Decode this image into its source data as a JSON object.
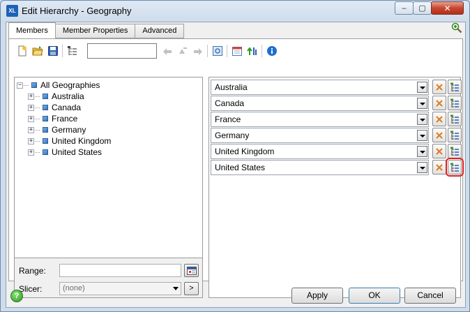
{
  "window": {
    "app_icon_text": "XL",
    "title": "Edit Hierarchy - Geography",
    "controls": {
      "minimize": "–",
      "maximize": "▢",
      "close": "✕"
    }
  },
  "tabs": [
    {
      "label": "Members",
      "active": true
    },
    {
      "label": "Member Properties",
      "active": false
    },
    {
      "label": "Advanced",
      "active": false
    }
  ],
  "toolbar": {
    "search_value": "",
    "icons": [
      "new-icon",
      "open-icon",
      "save-icon",
      "tree-view-icon",
      "move-left-icon",
      "move-up-icon",
      "move-right-icon",
      "preview-icon",
      "calendar-icon",
      "sort-icon",
      "info-icon"
    ]
  },
  "tree": {
    "root": {
      "label": "All Geographies",
      "expander": "−"
    },
    "children": [
      {
        "label": "Australia",
        "expander": "+"
      },
      {
        "label": "Canada",
        "expander": "+"
      },
      {
        "label": "France",
        "expander": "+"
      },
      {
        "label": "Germany",
        "expander": "+"
      },
      {
        "label": "United Kingdom",
        "expander": "+"
      },
      {
        "label": "United States",
        "expander": "+"
      }
    ]
  },
  "range": {
    "label": "Range:",
    "value": ""
  },
  "slicer": {
    "label": "Slicer:",
    "value": "(none)",
    "go_label": ">"
  },
  "members": [
    {
      "value": "Australia"
    },
    {
      "value": "Canada"
    },
    {
      "value": "France"
    },
    {
      "value": "Germany"
    },
    {
      "value": "United Kingdom"
    },
    {
      "value": "United States"
    }
  ],
  "footer": {
    "help_label": "?",
    "apply": "Apply",
    "ok": "OK",
    "cancel": "Cancel"
  },
  "colors": {
    "highlight": "#e02020",
    "accent": "#2f74c0",
    "delete": "#e07b1f"
  }
}
